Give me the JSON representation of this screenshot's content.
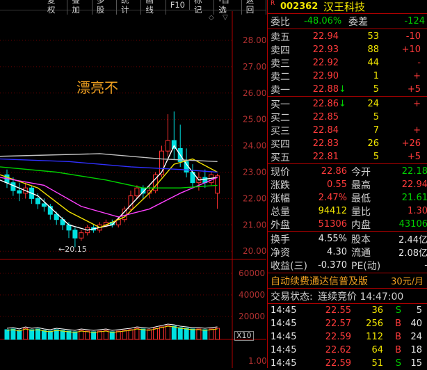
{
  "toolbar": {
    "items": [
      "复权",
      "叠加",
      "多股",
      "统计",
      "画线",
      "F10",
      "标记",
      "-自选",
      "返回"
    ]
  },
  "chart": {
    "annotation": "漂亮不",
    "low_marker": "←20.15",
    "price_ticks": [
      "28.00",
      "27.00",
      "26.00",
      "25.00",
      "24.00",
      "23.00",
      "22.00",
      "21.00",
      "20.00"
    ],
    "volume_ticks": [
      "60000",
      "40000",
      "20000"
    ],
    "volume_unit": "X10",
    "bottom_tick": "1.00",
    "colors": {
      "up": "#ff3030",
      "down": "#00e0e0",
      "ma5": "#ffffff",
      "ma10": "#f0e000",
      "ma20": "#ff40ff",
      "ma60": "#00d000",
      "ma120": "#3030ff",
      "ma250": "#c0c0c0"
    }
  },
  "stock": {
    "badge": "R",
    "code": "002362",
    "name": "汉王科技",
    "weibi_label": "委比",
    "weibi_value": "-48.06%",
    "weicha_label": "委差",
    "weicha_value": "-124"
  },
  "sells": [
    {
      "label": "卖五",
      "price": "22.94",
      "vol": "53",
      "chg": "-10",
      "arrow": ""
    },
    {
      "label": "卖四",
      "price": "22.93",
      "vol": "88",
      "chg": "+10",
      "arrow": ""
    },
    {
      "label": "卖三",
      "price": "22.92",
      "vol": "44",
      "chg": "-",
      "arrow": ""
    },
    {
      "label": "卖二",
      "price": "22.90",
      "vol": "1",
      "chg": "+",
      "arrow": ""
    },
    {
      "label": "卖一",
      "price": "22.88",
      "vol": "5",
      "chg": "+5",
      "arrow": "↓"
    }
  ],
  "buys": [
    {
      "label": "买一",
      "price": "22.86",
      "vol": "24",
      "chg": "+",
      "arrow": "↓"
    },
    {
      "label": "买二",
      "price": "22.85",
      "vol": "5",
      "chg": "",
      "arrow": ""
    },
    {
      "label": "买三",
      "price": "22.84",
      "vol": "7",
      "chg": "+",
      "arrow": ""
    },
    {
      "label": "买四",
      "price": "22.83",
      "vol": "26",
      "chg": "+26",
      "arrow": ""
    },
    {
      "label": "买五",
      "price": "22.81",
      "vol": "5",
      "chg": "+5",
      "arrow": ""
    }
  ],
  "quote": [
    {
      "l1": "现价",
      "v1": "22.86",
      "c1": "red",
      "l2": "今开",
      "v2": "22.18",
      "c2": "green"
    },
    {
      "l1": "涨跌",
      "v1": "0.55",
      "c1": "red",
      "l2": "最高",
      "v2": "22.94",
      "c2": "red"
    },
    {
      "l1": "涨幅",
      "v1": "2.47%",
      "c1": "red",
      "l2": "最低",
      "v2": "21.61",
      "c2": "green"
    },
    {
      "l1": "总量",
      "v1": "94412",
      "c1": "yellow",
      "l2": "量比",
      "v2": "1.30",
      "c2": "red"
    },
    {
      "l1": "外盘",
      "v1": "51306",
      "c1": "red",
      "l2": "内盘",
      "v2": "43106",
      "c2": "green"
    }
  ],
  "fund": [
    {
      "l1": "换手",
      "v1": "4.55%",
      "l2": "股本",
      "v2": "2.44亿"
    },
    {
      "l1": "净资",
      "v1": "4.30",
      "l2": "流通",
      "v2": "2.08亿"
    },
    {
      "l1": "收益(三)",
      "v1": "-0.370",
      "l2": "PE(动)",
      "v2": "-"
    }
  ],
  "promo": {
    "text": "自动续费通达信普及版",
    "price": "30元/月"
  },
  "trade_status": {
    "label": "交易状态:",
    "value": "连续竞价 14:47:00"
  },
  "ticks": [
    {
      "time": "14:45",
      "price": "22.55",
      "vol": "36",
      "bs": "S",
      "extra": "5"
    },
    {
      "time": "14:45",
      "price": "22.57",
      "vol": "256",
      "bs": "B",
      "extra": "40"
    },
    {
      "time": "14:45",
      "price": "22.59",
      "vol": "112",
      "bs": "B",
      "extra": "24"
    },
    {
      "time": "14:45",
      "price": "22.62",
      "vol": "64",
      "bs": "B",
      "extra": "18"
    },
    {
      "time": "14:45",
      "price": "22.59",
      "vol": "51",
      "bs": "S",
      "extra": "15"
    }
  ]
}
